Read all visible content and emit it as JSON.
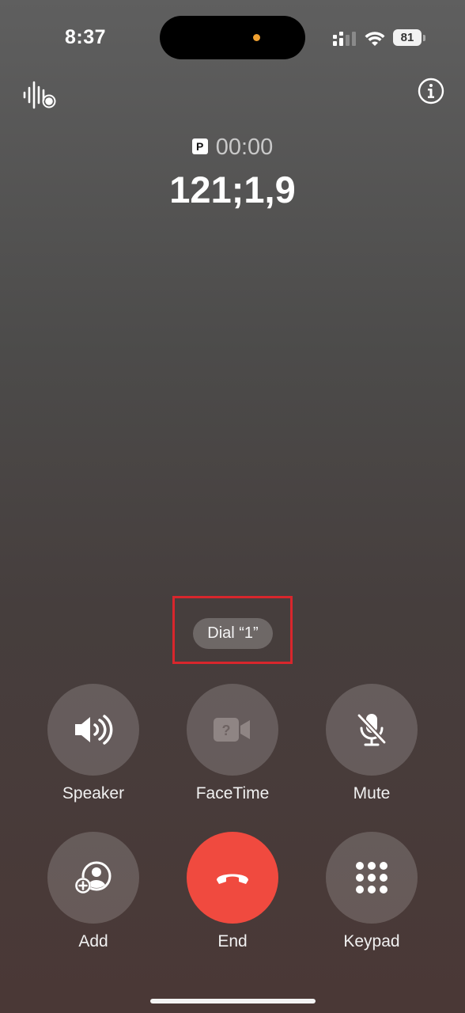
{
  "status_bar": {
    "time": "8:37",
    "battery_level": "81",
    "privacy_indicator_color": "#f0a030"
  },
  "top_bar": {
    "left_icon": "live-audio-record-icon",
    "right_icon": "info-icon"
  },
  "call": {
    "badge": "P",
    "duration": "00:00",
    "number": "121;1,9"
  },
  "dial_prompt": {
    "label": "Dial “1”",
    "highlight_color": "#d8262c"
  },
  "controls": {
    "speaker": {
      "label": "Speaker",
      "icon": "speaker-icon"
    },
    "facetime": {
      "label": "FaceTime",
      "icon": "facetime-unavailable-icon"
    },
    "mute": {
      "label": "Mute",
      "icon": "mute-icon"
    },
    "add": {
      "label": "Add",
      "icon": "add-person-icon"
    },
    "end": {
      "label": "End",
      "icon": "hang-up-icon",
      "color": "#f04a3f"
    },
    "keypad": {
      "label": "Keypad",
      "icon": "keypad-icon"
    }
  }
}
